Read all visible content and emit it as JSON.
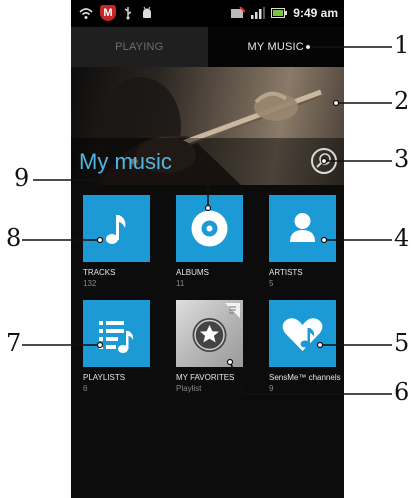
{
  "status_bar": {
    "time": "9:49 am",
    "icons": [
      "wifi-icon",
      "mcafee-shield-icon",
      "usb-icon",
      "android-debug-icon",
      "sim-icon",
      "signal-icon",
      "battery-icon"
    ]
  },
  "tabs": [
    {
      "label": "PLAYING",
      "active": false
    },
    {
      "label": "MY MUSIC",
      "active": true
    }
  ],
  "header": {
    "title": "My music"
  },
  "tiles": [
    {
      "label": "TRACKS",
      "count": "132",
      "icon": "music-note-icon"
    },
    {
      "label": "ALBUMS",
      "count": "11",
      "icon": "disc-icon"
    },
    {
      "label": "ARTISTS",
      "count": "5",
      "icon": "person-icon"
    },
    {
      "label": "PLAYLISTS",
      "count": "6",
      "icon": "playlist-icon"
    },
    {
      "label": "MY FAVORITES",
      "count": "Playlist",
      "icon": "star-icon"
    },
    {
      "label": "SensMe™ channels",
      "count": "9",
      "icon": "heart-note-icon"
    }
  ],
  "callouts": [
    "1",
    "2",
    "3",
    "4",
    "5",
    "6",
    "7",
    "8",
    "9"
  ],
  "colors": {
    "accent": "#4fb6e3",
    "tile_blue": "#1b9ad6",
    "background": "#0c0c0c"
  }
}
